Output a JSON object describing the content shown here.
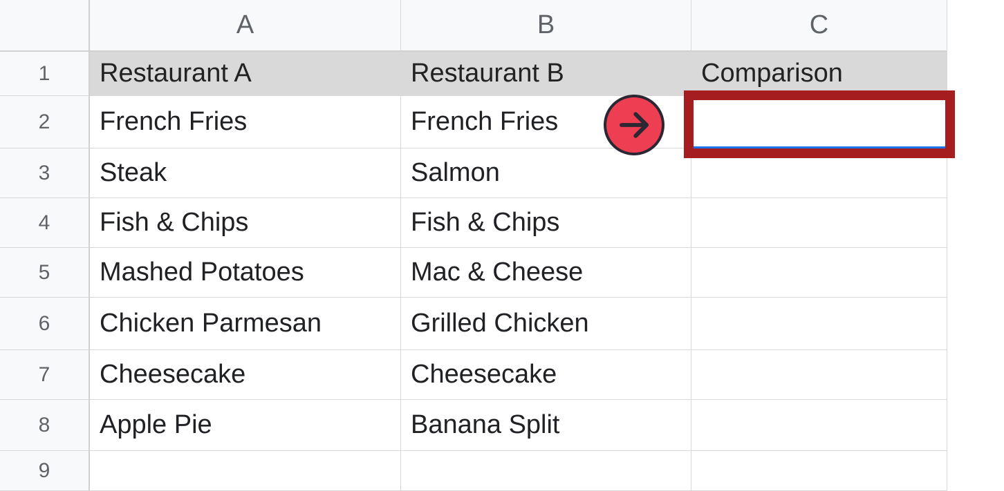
{
  "columns": [
    "A",
    "B",
    "C"
  ],
  "rows": [
    "1",
    "2",
    "3",
    "4",
    "5",
    "6",
    "7",
    "8",
    "9"
  ],
  "data": {
    "header": {
      "a": "Restaurant A",
      "b": "Restaurant B",
      "c": "Comparison"
    },
    "body": [
      {
        "a": "French Fries",
        "b": "French Fries",
        "c": ""
      },
      {
        "a": "Steak",
        "b": "Salmon",
        "c": ""
      },
      {
        "a": "Fish & Chips",
        "b": "Fish & Chips",
        "c": ""
      },
      {
        "a": "Mashed Potatoes",
        "b": "Mac & Cheese",
        "c": ""
      },
      {
        "a": "Chicken Parmesan",
        "b": "Grilled Chicken",
        "c": ""
      },
      {
        "a": "Cheesecake",
        "b": "Cheesecake",
        "c": ""
      },
      {
        "a": "Apple Pie",
        "b": "Banana Split",
        "c": ""
      },
      {
        "a": "",
        "b": "",
        "c": ""
      }
    ]
  },
  "selected_cell": "C2",
  "annotations": {
    "arrow_icon": "arrow-right",
    "arrow_color": "#ee3e52",
    "highlight_box_color": "#a61d20"
  }
}
